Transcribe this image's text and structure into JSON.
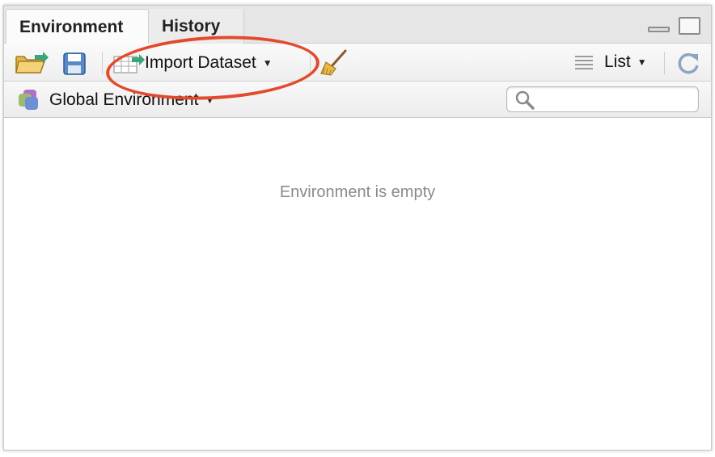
{
  "tabs": [
    {
      "label": "Environment",
      "active": true
    },
    {
      "label": "History",
      "active": false
    }
  ],
  "toolbar": {
    "import_label": "Import Dataset",
    "view_label": "List"
  },
  "env_bar": {
    "scope_label": "Global Environment",
    "search_placeholder": ""
  },
  "main": {
    "empty_message": "Environment is empty"
  },
  "colors": {
    "annotation": "#e24a2e",
    "empty_text": "#8a8a8a"
  },
  "icons": [
    "open-folder-icon",
    "save-icon",
    "import-table-icon",
    "broom-icon",
    "list-lines-icon",
    "refresh-icon",
    "environments-icon",
    "search-icon",
    "minimize-icon",
    "maximize-icon"
  ]
}
